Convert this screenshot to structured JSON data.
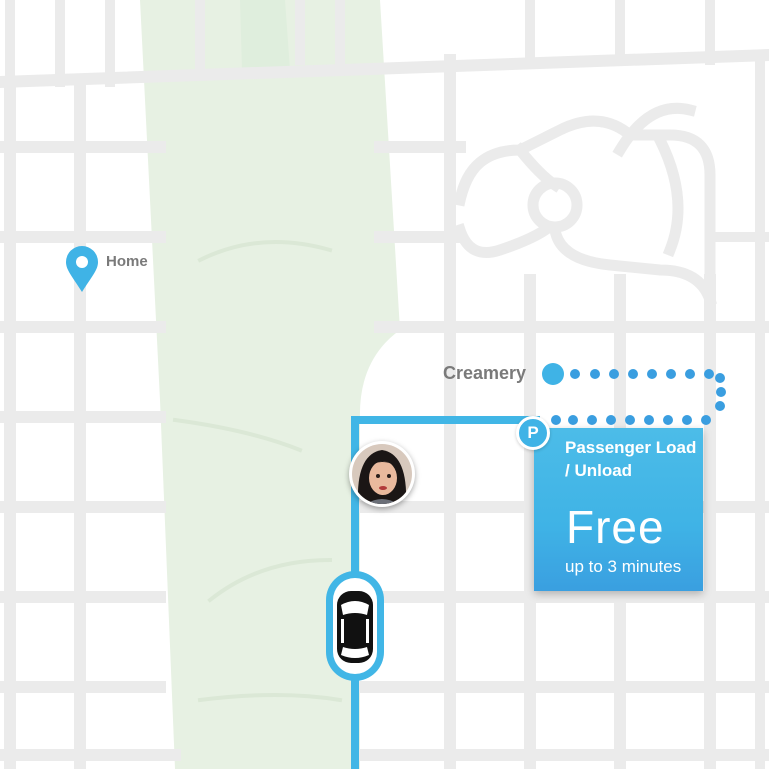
{
  "map": {
    "places": {
      "home": {
        "label": "Home",
        "icon": "map-pin-icon"
      },
      "creamery": {
        "label": "Creamery",
        "icon": "destination-dot-icon"
      }
    },
    "parking": {
      "badge": "P",
      "title": "Passenger Load / Unload",
      "price": "Free",
      "duration": "up to 3 minutes"
    },
    "driver": {
      "icon": "driver-avatar-icon"
    },
    "vehicle": {
      "icon": "car-icon"
    },
    "colors": {
      "route": "#41b6e6",
      "park": "#e6f0e1",
      "street": "#ebebeb",
      "label_text": "#7a7a7a",
      "card": "#3fb3e6"
    }
  }
}
